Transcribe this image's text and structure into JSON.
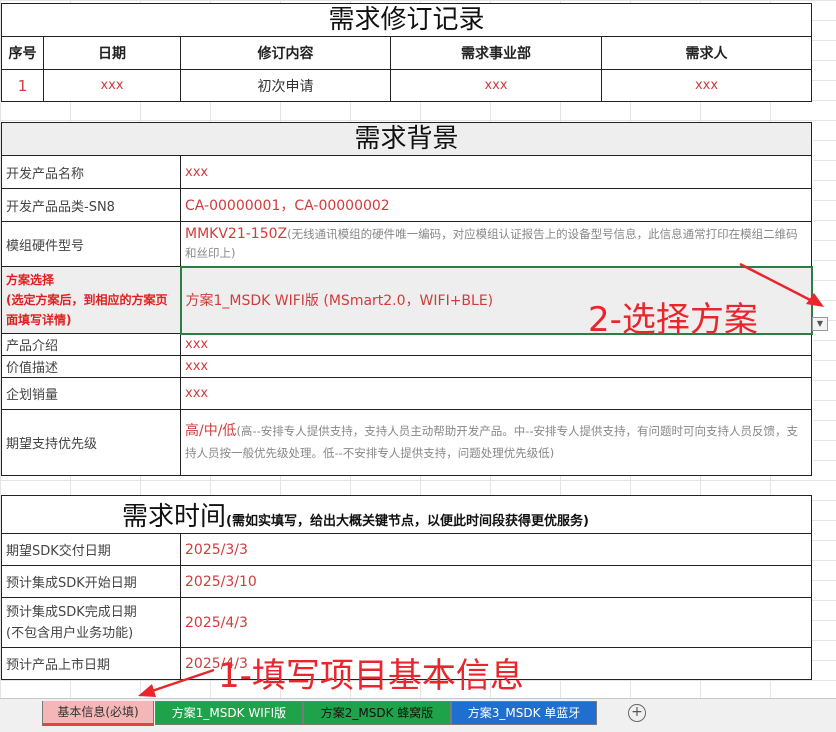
{
  "revision": {
    "title": "需求修订记录",
    "headers": [
      "序号",
      "日期",
      "修订内容",
      "需求事业部",
      "需求人"
    ],
    "rows": [
      [
        "1",
        "xxx",
        "初次申请",
        "xxx",
        "xxx"
      ]
    ]
  },
  "background": {
    "title": "需求背景",
    "rows": [
      {
        "label": "开发产品名称",
        "value": "xxx"
      },
      {
        "label": "开发产品品类-SN8",
        "value": "CA-00000001，CA-00000002"
      },
      {
        "label": "模组硬件型号",
        "value": "MMKV21-150Z",
        "note": "(无线通讯模组的硬件唯一编码，对应模组认证报告上的设备型号信息，此信息通常打印在模组二维码和丝印上)"
      },
      {
        "label": "方案选择\n(选定方案后，到相应的方案页面填写详情)",
        "value": "方案1_MSDK WIFI版 (MSmart2.0，WIFI+BLE)"
      },
      {
        "label": "产品介绍",
        "value": "xxx"
      },
      {
        "label": "价值描述",
        "value": "xxx"
      },
      {
        "label": "企划销量",
        "value": "xxx"
      },
      {
        "label": "期望支持优先级",
        "value": "高/中/低",
        "note": "(高--安排专人提供支持，支持人员主动帮助开发产品。中--安排专人提供支持，有问题时可向支持人员反馈，支持人员按一般优先级处理。低--不安排专人提供支持，问题处理优先级低)"
      }
    ]
  },
  "timeline": {
    "title": "需求时间",
    "subtitle": "(需如实填写，给出大概关键节点，以便此时间段获得更优服务)",
    "rows": [
      {
        "label": "期望SDK交付日期",
        "value": "2025/3/3"
      },
      {
        "label": "预计集成SDK开始日期",
        "value": "2025/3/10"
      },
      {
        "label": "预计集成SDK完成日期\n(不包含用户业务功能)",
        "value": "2025/4/3"
      },
      {
        "label": "预计产品上市日期",
        "value": "2025/4/3"
      }
    ]
  },
  "annotations": {
    "step1": "1-填写项目基本信息",
    "step2": "2-选择方案"
  },
  "tabs": [
    {
      "label": "基本信息(必填)",
      "color": "#f4b6b6",
      "text_color": "#333333"
    },
    {
      "label": "方案1_MSDK WIFI版",
      "color": "#1fa34a",
      "text_color": "#ffffff"
    },
    {
      "label": "方案2_MSDK 蜂窝版",
      "color": "#1fa34a",
      "text_color": "#111111"
    },
    {
      "label": "方案3_MSDK 单蓝牙",
      "color": "#1f6fd1",
      "text_color": "#ffffff"
    }
  ],
  "add_sheet_icon": "plus-circle-icon",
  "dropdown_icon": "chevron-down-icon"
}
